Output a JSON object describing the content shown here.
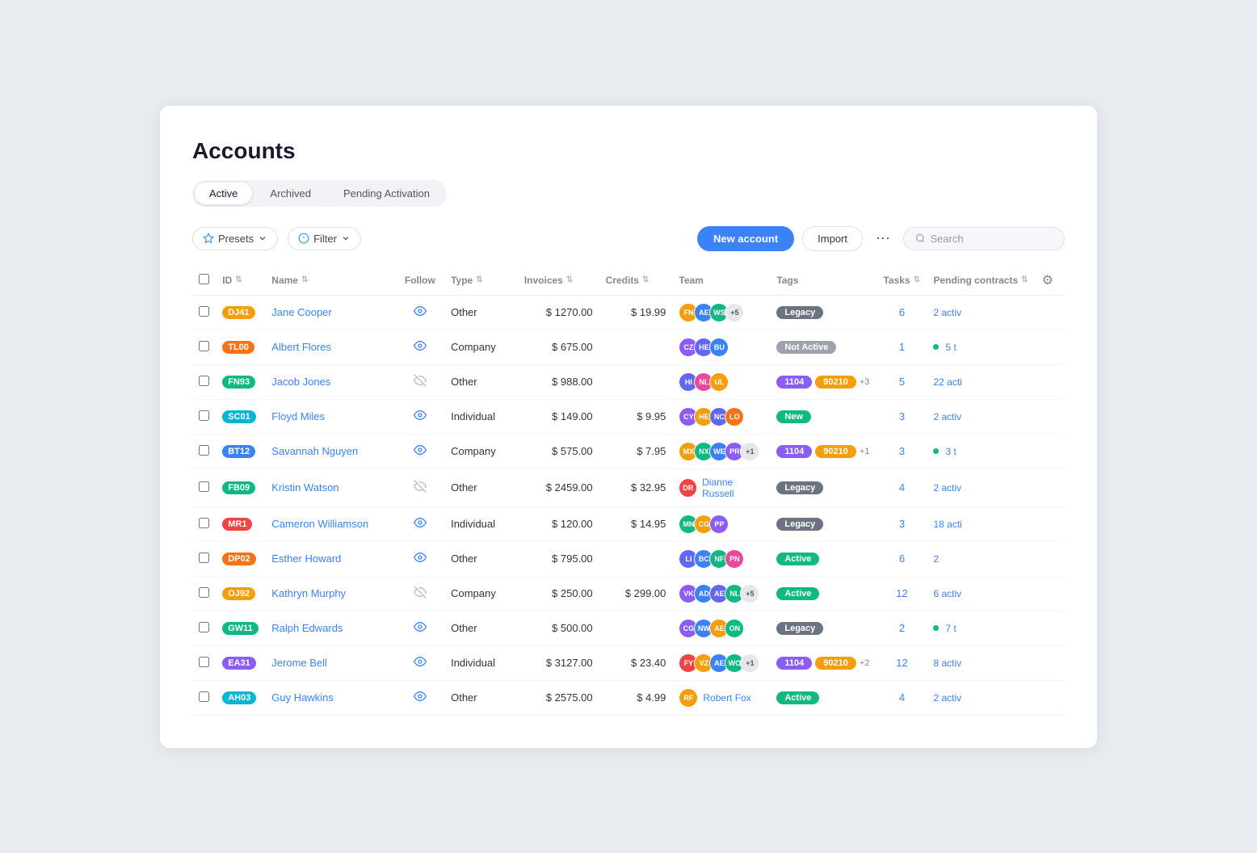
{
  "page": {
    "title": "Accounts"
  },
  "tabs": [
    {
      "id": "active",
      "label": "Active",
      "active": true
    },
    {
      "id": "archived",
      "label": "Archived",
      "active": false
    },
    {
      "id": "pending",
      "label": "Pending Activation",
      "active": false
    }
  ],
  "toolbar": {
    "presets_label": "Presets",
    "filter_label": "Filter",
    "new_account_label": "New account",
    "import_label": "Import",
    "search_placeholder": "Search"
  },
  "columns": [
    {
      "id": "id",
      "label": "ID"
    },
    {
      "id": "name",
      "label": "Name"
    },
    {
      "id": "follow",
      "label": "Follow"
    },
    {
      "id": "type",
      "label": "Type"
    },
    {
      "id": "invoices",
      "label": "Invoices"
    },
    {
      "id": "credits",
      "label": "Credits"
    },
    {
      "id": "team",
      "label": "Team"
    },
    {
      "id": "tags",
      "label": "Tags"
    },
    {
      "id": "tasks",
      "label": "Tasks"
    },
    {
      "id": "pending_contracts",
      "label": "Pending contracts"
    }
  ],
  "rows": [
    {
      "id": "DJ41",
      "id_color": "#f59e0b",
      "name": "Jane Cooper",
      "follow": true,
      "type": "Other",
      "invoices": "$ 1270.00",
      "credits": "$ 19.99",
      "team": [
        {
          "initials": "FN",
          "color": "#f59e0b"
        },
        {
          "initials": "AE",
          "color": "#3b82f6"
        },
        {
          "initials": "WS",
          "color": "#10b981"
        }
      ],
      "team_extra": "+5",
      "tags": [
        "Legacy"
      ],
      "tasks": "6",
      "tasks_link": true,
      "pending": "2 activ",
      "pending_dot": false
    },
    {
      "id": "TL00",
      "id_color": "#f97316",
      "name": "Albert Flores",
      "follow": true,
      "type": "Company",
      "invoices": "$ 675.00",
      "credits": "",
      "team": [
        {
          "initials": "CZ",
          "color": "#8b5cf6"
        },
        {
          "initials": "HE",
          "color": "#6366f1"
        },
        {
          "initials": "BU",
          "color": "#3b82f6"
        }
      ],
      "team_extra": "",
      "tags": [
        "Not Active"
      ],
      "tasks": "1",
      "tasks_link": true,
      "pending": "5 t",
      "pending_dot": true
    },
    {
      "id": "FN93",
      "id_color": "#10b981",
      "name": "Jacob Jones",
      "follow": false,
      "type": "Other",
      "invoices": "$ 988.00",
      "credits": "",
      "team": [
        {
          "initials": "HI",
          "color": "#6366f1"
        },
        {
          "initials": "NL",
          "color": "#ec4899"
        },
        {
          "initials": "UL",
          "color": "#f59e0b"
        }
      ],
      "team_extra": "",
      "tags": [
        "1104",
        "90210"
      ],
      "tags_extra": "+3",
      "tasks": "5",
      "tasks_link": true,
      "pending": "22 acti",
      "pending_dot": false
    },
    {
      "id": "SC01",
      "id_color": "#06b6d4",
      "name": "Floyd Miles",
      "follow": true,
      "type": "Individual",
      "invoices": "$ 149.00",
      "credits": "$ 9.95",
      "team": [
        {
          "initials": "CY",
          "color": "#8b5cf6"
        },
        {
          "initials": "HE",
          "color": "#f59e0b"
        },
        {
          "initials": "NC",
          "color": "#6366f1"
        },
        {
          "initials": "LO",
          "color": "#f97316"
        }
      ],
      "team_extra": "",
      "tags": [
        "New"
      ],
      "tasks": "3",
      "tasks_link": true,
      "pending": "2 activ",
      "pending_dot": false
    },
    {
      "id": "BT12",
      "id_color": "#3b82f6",
      "name": "Savannah Nguyen",
      "follow": true,
      "type": "Company",
      "invoices": "$ 575.00",
      "credits": "$ 7.95",
      "team": [
        {
          "initials": "MX",
          "color": "#f59e0b"
        },
        {
          "initials": "NX",
          "color": "#10b981"
        },
        {
          "initials": "WE",
          "color": "#3b82f6"
        },
        {
          "initials": "PR",
          "color": "#8b5cf6"
        }
      ],
      "team_extra": "+1",
      "tags": [
        "1104",
        "90210"
      ],
      "tags_extra": "+1",
      "tasks": "3",
      "tasks_link": true,
      "pending": "3 t",
      "pending_dot": true
    },
    {
      "id": "FB09",
      "id_color": "#10b981",
      "name": "Kristin Watson",
      "follow": false,
      "type": "Other",
      "invoices": "$ 2459.00",
      "credits": "$ 32.95",
      "team": [
        {
          "initials": "DR",
          "color": "#ef4444"
        }
      ],
      "team_ref": "Dianne Russell",
      "team_extra": "",
      "tags": [
        "Legacy"
      ],
      "tasks": "4",
      "tasks_link": true,
      "pending": "2 activ",
      "pending_dot": false
    },
    {
      "id": "MR1",
      "id_color": "#ef4444",
      "name": "Cameron Williamson",
      "follow": true,
      "type": "Individual",
      "invoices": "$ 120.00",
      "credits": "$ 14.95",
      "team": [
        {
          "initials": "MN",
          "color": "#10b981"
        },
        {
          "initials": "CG",
          "color": "#f59e0b"
        },
        {
          "initials": "PP",
          "color": "#8b5cf6"
        }
      ],
      "team_extra": "",
      "tags": [
        "Legacy"
      ],
      "tasks": "3",
      "tasks_link": true,
      "pending": "18 acti",
      "pending_dot": false
    },
    {
      "id": "DP02",
      "id_color": "#f97316",
      "name": "Esther Howard",
      "follow": true,
      "type": "Other",
      "invoices": "$ 795.00",
      "credits": "",
      "team": [
        {
          "initials": "LI",
          "color": "#6366f1"
        },
        {
          "initials": "BC",
          "color": "#3b82f6"
        },
        {
          "initials": "NF",
          "color": "#10b981"
        },
        {
          "initials": "PN",
          "color": "#ec4899"
        }
      ],
      "team_extra": "",
      "tags": [
        "Active"
      ],
      "tasks": "6",
      "tasks_link": true,
      "pending": "2",
      "pending_dot": false
    },
    {
      "id": "OJ92",
      "id_color": "#f59e0b",
      "name": "Kathryn Murphy",
      "follow": false,
      "type": "Company",
      "invoices": "$ 250.00",
      "credits": "$ 299.00",
      "team": [
        {
          "initials": "VK",
          "color": "#8b5cf6"
        },
        {
          "initials": "AD",
          "color": "#3b82f6"
        },
        {
          "initials": "AE",
          "color": "#6366f1"
        },
        {
          "initials": "NL",
          "color": "#10b981"
        }
      ],
      "team_extra": "+5",
      "tags": [
        "Active"
      ],
      "tasks": "12",
      "tasks_link": true,
      "pending": "6 activ",
      "pending_dot": false
    },
    {
      "id": "GW11",
      "id_color": "#10b981",
      "name": "Ralph Edwards",
      "follow": true,
      "type": "Other",
      "invoices": "$ 500.00",
      "credits": "",
      "team": [
        {
          "initials": "CG",
          "color": "#8b5cf6"
        },
        {
          "initials": "NW",
          "color": "#3b82f6"
        },
        {
          "initials": "AE",
          "color": "#f59e0b"
        },
        {
          "initials": "ON",
          "color": "#10b981"
        }
      ],
      "team_extra": "",
      "tags": [
        "Legacy"
      ],
      "tasks": "2",
      "tasks_link": true,
      "pending": "7 t",
      "pending_dot": true
    },
    {
      "id": "EA31",
      "id_color": "#8b5cf6",
      "name": "Jerome Bell",
      "follow": true,
      "type": "Individual",
      "invoices": "$ 3127.00",
      "credits": "$ 23.40",
      "team": [
        {
          "initials": "FY",
          "color": "#ef4444"
        },
        {
          "initials": "VZ",
          "color": "#f59e0b"
        },
        {
          "initials": "AE",
          "color": "#3b82f6"
        },
        {
          "initials": "WO",
          "color": "#10b981"
        }
      ],
      "team_extra": "+1",
      "tags": [
        "1104",
        "90210"
      ],
      "tags_extra": "+2",
      "tasks": "12",
      "tasks_link": true,
      "pending": "8 activ",
      "pending_dot": false
    },
    {
      "id": "AH03",
      "id_color": "#06b6d4",
      "name": "Guy Hawkins",
      "follow": true,
      "type": "Other",
      "invoices": "$ 2575.00",
      "credits": "$ 4.99",
      "team": [
        {
          "initials": "RF",
          "color": "#f59e0b"
        }
      ],
      "team_ref": "Robert Fox",
      "team_extra": "",
      "tags": [
        "Active"
      ],
      "tasks": "4",
      "tasks_link": true,
      "pending": "2 activ",
      "pending_dot": false
    }
  ]
}
